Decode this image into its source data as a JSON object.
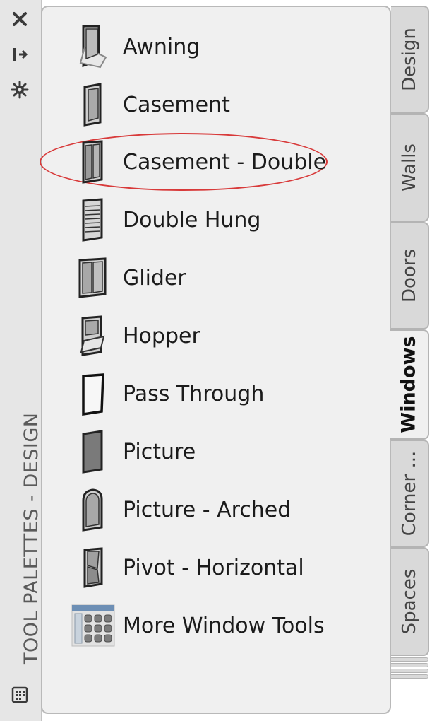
{
  "titlebar": {
    "title": "TOOL PALETTES - DESIGN",
    "close_icon": "close-icon",
    "autohide_icon": "autohide-icon",
    "properties_icon": "gear-icon",
    "bottom_icon": "palette-grid-icon"
  },
  "palette": {
    "items": [
      {
        "label": "Awning",
        "icon": "awning-window-icon"
      },
      {
        "label": "Casement",
        "icon": "casement-window-icon"
      },
      {
        "label": "Casement - Double",
        "icon": "casement-double-window-icon"
      },
      {
        "label": "Double Hung",
        "icon": "double-hung-window-icon"
      },
      {
        "label": "Glider",
        "icon": "glider-window-icon"
      },
      {
        "label": "Hopper",
        "icon": "hopper-window-icon"
      },
      {
        "label": "Pass Through",
        "icon": "pass-through-window-icon"
      },
      {
        "label": "Picture",
        "icon": "picture-window-icon"
      },
      {
        "label": "Picture - Arched",
        "icon": "picture-arched-window-icon"
      },
      {
        "label": "Pivot - Horizontal",
        "icon": "pivot-horizontal-window-icon"
      },
      {
        "label": "More Window Tools",
        "icon": "more-window-tools-icon"
      }
    ],
    "highlighted_item": "Casement - Double",
    "highlight_color": "#d83a3a"
  },
  "tabs": [
    {
      "label": "Design",
      "active": false
    },
    {
      "label": "Walls",
      "active": false
    },
    {
      "label": "Doors",
      "active": false
    },
    {
      "label": "Windows",
      "active": true
    },
    {
      "label": "Corner ...",
      "active": false
    },
    {
      "label": "Spaces",
      "active": false
    }
  ]
}
